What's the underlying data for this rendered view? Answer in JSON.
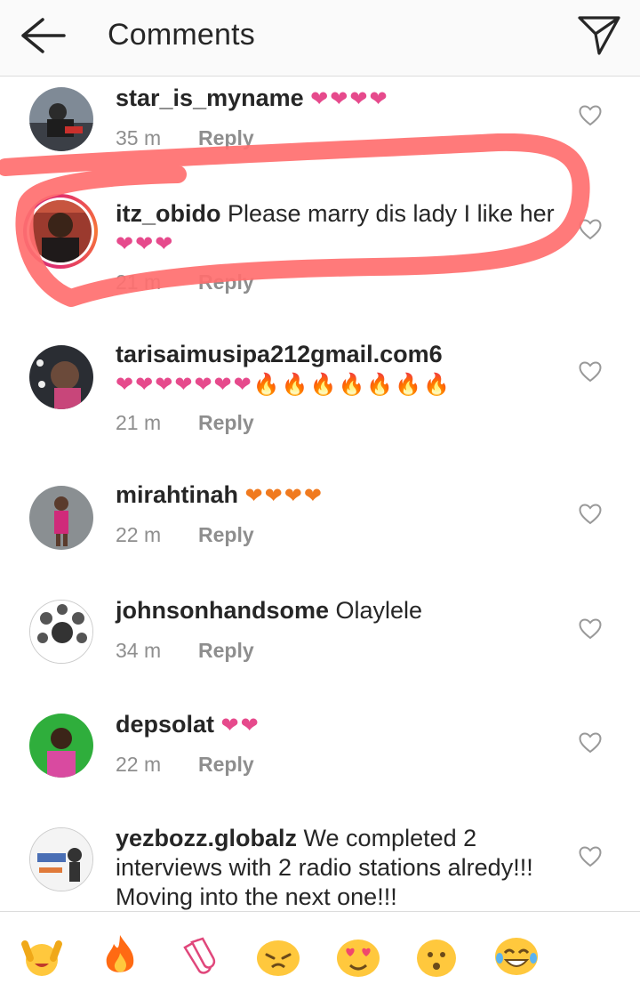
{
  "header": {
    "title": "Comments"
  },
  "comments": [
    {
      "username": "star_is_myname",
      "text": " ",
      "emoji": "❤❤❤❤",
      "emoji_kind": "pink",
      "time": "35 m",
      "reply": "Reply"
    },
    {
      "username": "itz_obido",
      "text": " Please marry dis lady I like her",
      "emoji": "❤❤❤",
      "emoji_kind": "pink",
      "time": "21 m",
      "reply": "Reply"
    },
    {
      "username": "tarisaimusipa212gmail.com6",
      "text": " ",
      "emoji": "❤❤❤❤❤❤❤🔥🔥🔥🔥🔥🔥🔥",
      "emoji_kind": "mixed",
      "time": "21 m",
      "reply": "Reply"
    },
    {
      "username": "mirahtinah",
      "text": " ",
      "emoji": "❤❤❤❤",
      "emoji_kind": "orange",
      "time": "22 m",
      "reply": "Reply"
    },
    {
      "username": "johnsonhandsome",
      "text": " Olaylele",
      "emoji": "",
      "emoji_kind": "none",
      "time": "34 m",
      "reply": "Reply"
    },
    {
      "username": "depsolat",
      "text": " ",
      "emoji": "❤❤",
      "emoji_kind": "pink",
      "time": "22 m",
      "reply": "Reply"
    },
    {
      "username": "yezbozz.globalz",
      "text": " We completed 2 interviews with 2 radio stations alredy!!! Moving into the next one!!!",
      "emoji": "",
      "emoji_kind": "none",
      "time": "",
      "reply": ""
    }
  ],
  "emoji_bar": [
    "🙌",
    "🔥",
    "👏",
    "😢",
    "😍",
    "😮",
    "😂"
  ],
  "colors": {
    "highlight": "#ff6f6f",
    "story_ring": "#e1306c",
    "meta_gray": "#8e8e8e"
  }
}
